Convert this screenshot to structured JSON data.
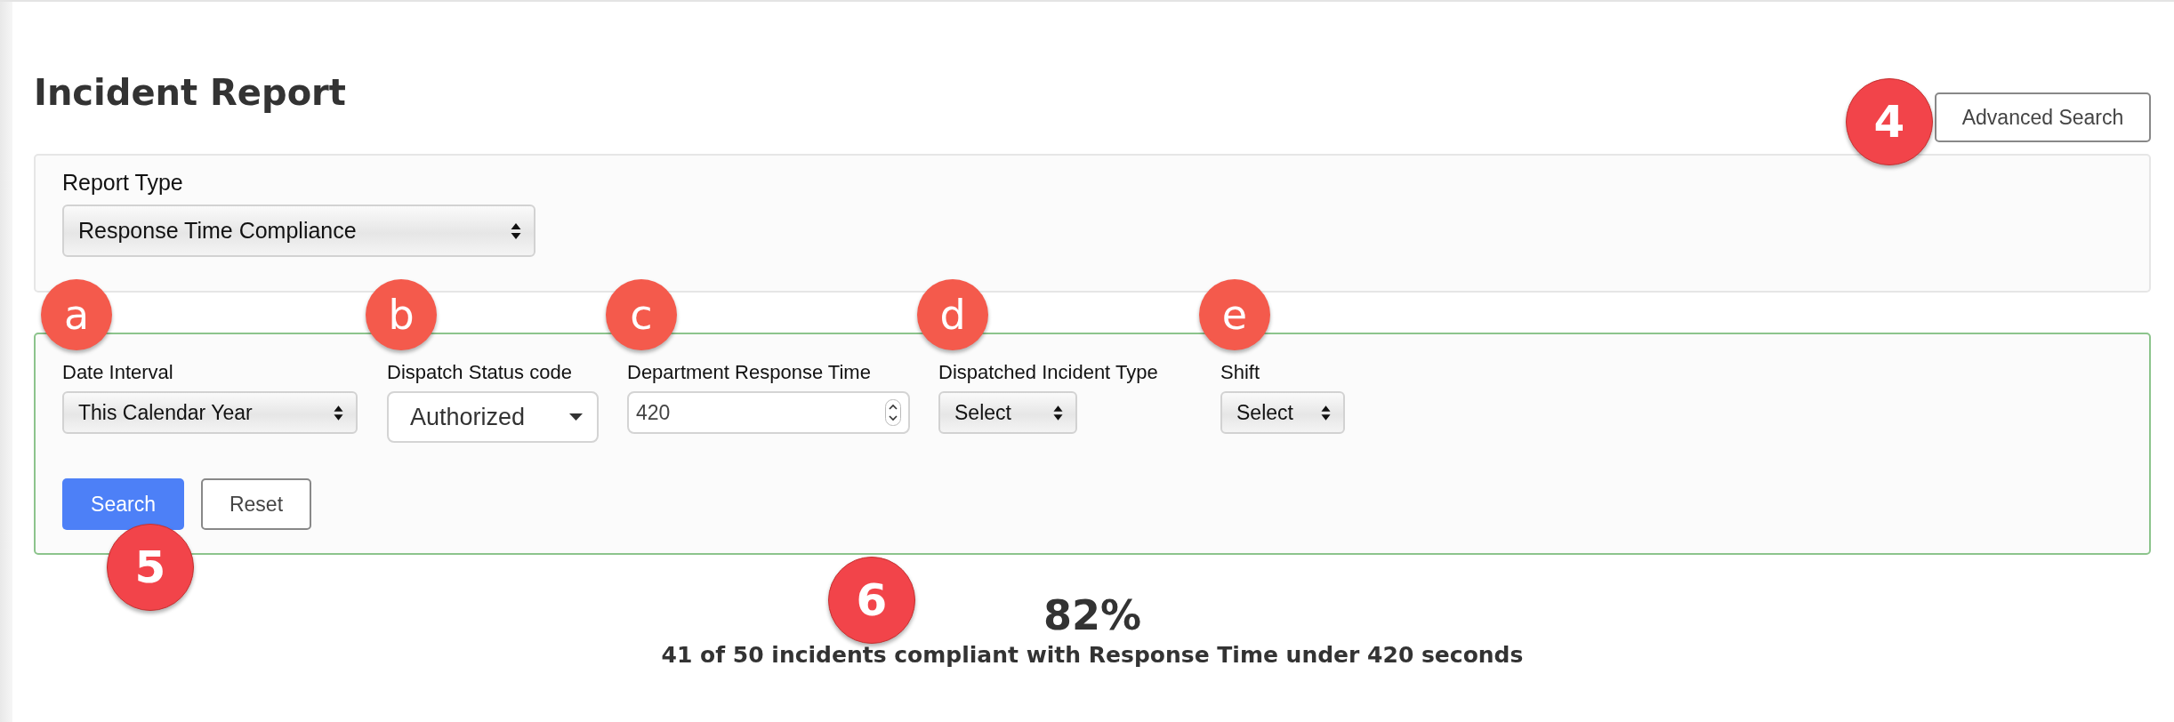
{
  "title": "Incident Report",
  "advanced_search": {
    "label": "Advanced Search",
    "badge": "4"
  },
  "report_type": {
    "label": "Report Type",
    "value": "Response Time Compliance"
  },
  "filters": [
    {
      "label": "Date Interval",
      "kind": "select",
      "value": "This Calendar Year",
      "badge": "a"
    },
    {
      "label": "Dispatch Status code",
      "kind": "dropdown",
      "value": "Authorized",
      "badge": "b"
    },
    {
      "label": "Department Response Time",
      "kind": "number",
      "value": "420",
      "badge": "c"
    },
    {
      "label": "Dispatched Incident Type",
      "kind": "select",
      "value": "Select",
      "badge": "d"
    },
    {
      "label": "Shift",
      "kind": "select",
      "value": "Select",
      "badge": "e"
    }
  ],
  "buttons": [
    {
      "label": "Search",
      "kind": "primary",
      "badge": "5"
    },
    {
      "label": "Reset",
      "kind": "secondary"
    }
  ],
  "result": {
    "percent": "82%",
    "summary": "41 of 50 incidents compliant with Response Time under 420 seconds",
    "badge": "6"
  }
}
